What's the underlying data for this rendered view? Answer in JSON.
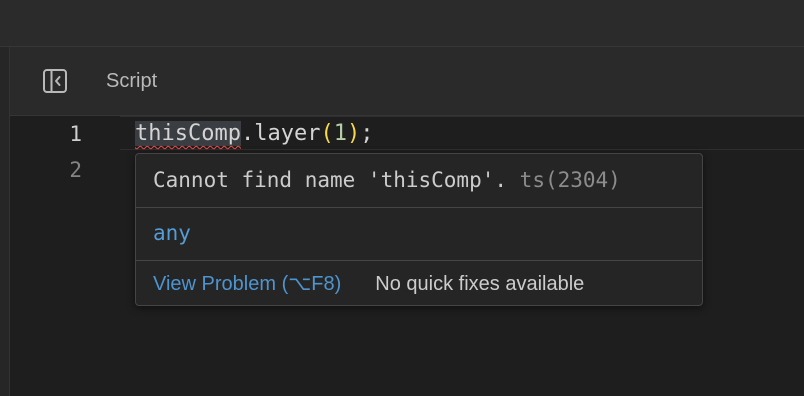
{
  "header": {
    "title": "Script",
    "sidebar_toggle_icon": "sidebar-toggle-icon"
  },
  "editor": {
    "line_numbers": [
      "1",
      "2"
    ],
    "code": {
      "identifier": "thisComp",
      "dot_member": ".layer",
      "open_paren": "(",
      "argument": "1",
      "close_paren": ")",
      "semicolon": ";"
    }
  },
  "hover": {
    "message": "Cannot find name 'thisComp'.",
    "error_code": "ts(2304)",
    "type": "any",
    "view_problem": "View Problem (⌥F8)",
    "no_quick_fixes": "No quick fixes available"
  },
  "colors": {
    "background": "#1e1e1e",
    "header_bg": "#2a2a2a",
    "link": "#4e94ce",
    "type_keyword": "#569cd6",
    "error_underline": "#f14c4c",
    "bracket": "#f9d849",
    "number": "#b5cea8"
  }
}
